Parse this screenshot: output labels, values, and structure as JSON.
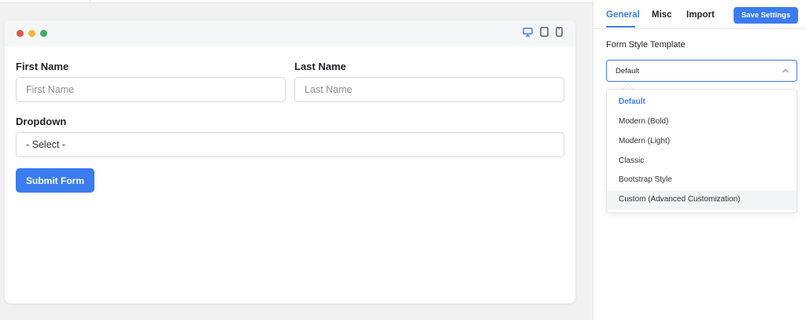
{
  "colors": {
    "accent": "#3b7cf0",
    "dot_red": "#e0564f",
    "dot_yellow": "#efb73a",
    "dot_green": "#3fae65"
  },
  "preview": {
    "device_icons": [
      "desktop-icon",
      "tablet-icon",
      "mobile-icon"
    ],
    "form": {
      "first_name": {
        "label": "First Name",
        "placeholder": "First Name"
      },
      "last_name": {
        "label": "Last Name",
        "placeholder": "Last Name"
      },
      "dropdown": {
        "label": "Dropdown",
        "value": "- Select -"
      },
      "submit_label": "Submit Form"
    }
  },
  "settings": {
    "tabs": [
      {
        "label": "General",
        "active": true
      },
      {
        "label": "Misc",
        "active": false
      },
      {
        "label": "Import",
        "active": false
      }
    ],
    "save_label": "Save Settings",
    "template_label": "Form Style Template",
    "template_value": "Default",
    "options": [
      "Default",
      "Modern (Bold)",
      "Modern (Light)",
      "Classic",
      "Bootstrap Style",
      "Custom (Advanced Customization)"
    ]
  }
}
